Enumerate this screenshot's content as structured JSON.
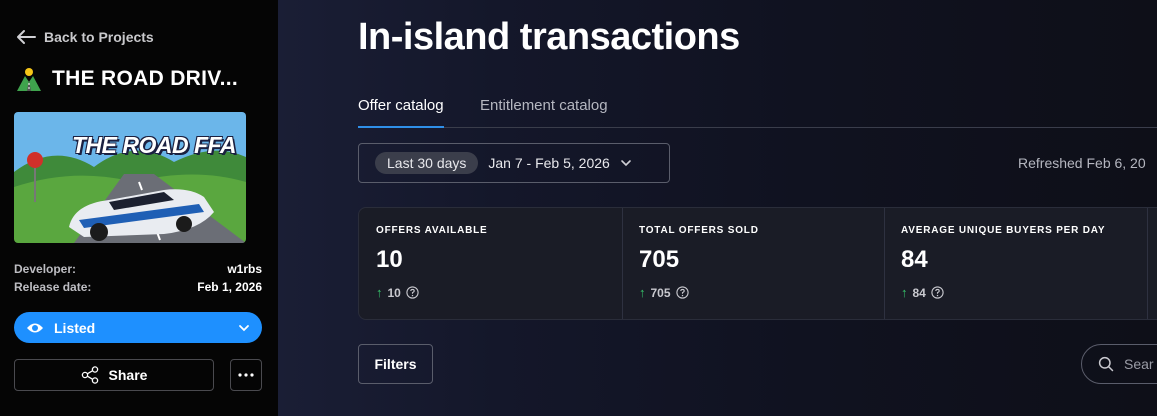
{
  "sidebar": {
    "back_label": "Back to Projects",
    "project_title": "THE ROAD DRIV...",
    "thumbnail_text": "THE ROAD FFA",
    "developer_label": "Developer:",
    "developer_value": "w1rbs",
    "release_label": "Release date:",
    "release_value": "Feb 1, 2026",
    "status_label": "Listed",
    "share_label": "Share",
    "accent": "#1e90ff"
  },
  "main": {
    "title": "In-island transactions",
    "tabs": [
      {
        "label": "Offer catalog",
        "active": true
      },
      {
        "label": "Entitlement catalog",
        "active": false
      }
    ],
    "date_pill": "Last 30 days",
    "date_range": "Jan 7 - Feb 5, 2026",
    "refreshed": "Refreshed Feb 6, 20",
    "stats": [
      {
        "label": "OFFERS AVAILABLE",
        "value": "10",
        "delta": "10"
      },
      {
        "label": "TOTAL OFFERS SOLD",
        "value": "705",
        "delta": "705"
      },
      {
        "label": "AVERAGE UNIQUE BUYERS PER DAY",
        "value": "84",
        "delta": "84"
      }
    ],
    "filters_label": "Filters",
    "search_placeholder": "Sear",
    "up_color": "#36c46b"
  }
}
